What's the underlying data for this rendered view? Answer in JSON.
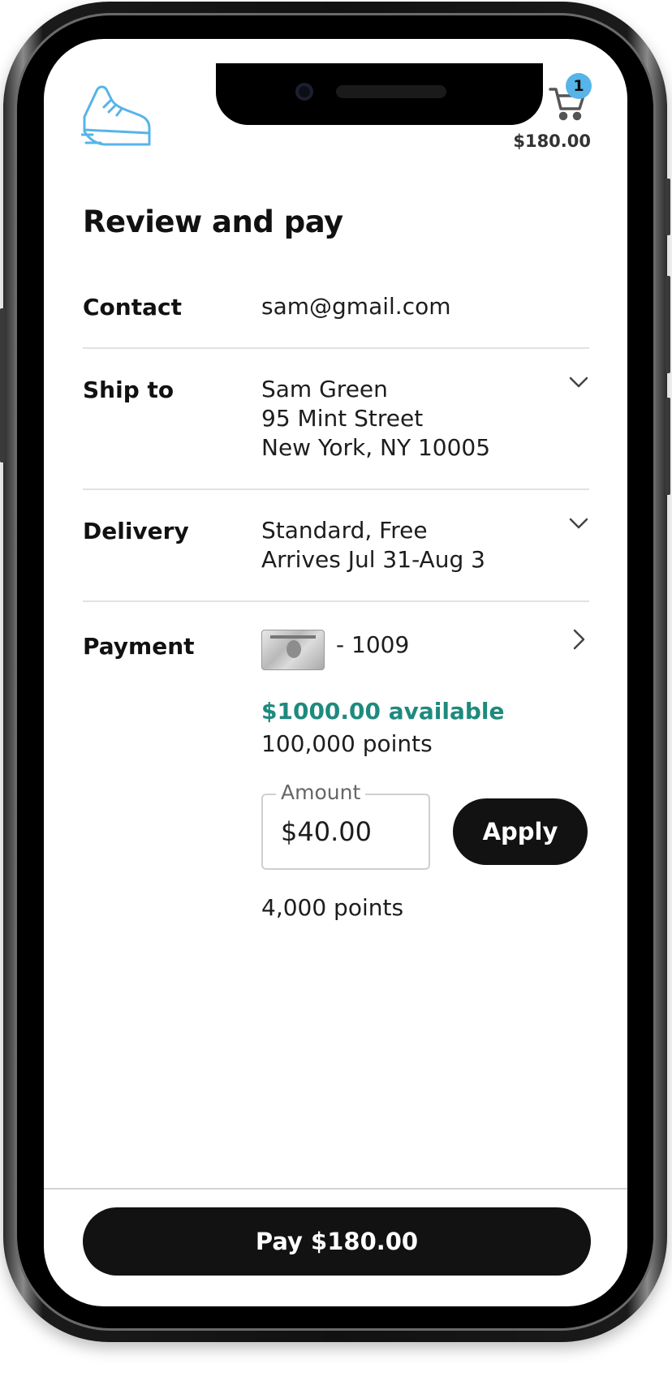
{
  "header": {
    "cart_count": "1",
    "cart_total": "$180.00"
  },
  "page": {
    "title": "Review and pay"
  },
  "contact": {
    "label": "Contact",
    "value": "sam@gmail.com"
  },
  "ship_to": {
    "label": "Ship to",
    "name": "Sam Green",
    "street": "95 Mint Street",
    "city": "New York, NY 10005"
  },
  "delivery": {
    "label": "Delivery",
    "method": "Standard, Free",
    "arrival": "Arrives Jul 31-Aug 3"
  },
  "payment": {
    "label": "Payment",
    "card_last4": "- 1009",
    "available": "$1000.00 available",
    "points": "100,000 points",
    "amount_label": "Amount",
    "amount_value": "$40.00",
    "apply_label": "Apply",
    "points_applied": "4,000 points"
  },
  "footer": {
    "pay_label": "Pay $180.00"
  },
  "colors": {
    "accent_blue": "#56b4e9",
    "available_green": "#1e8a7e",
    "button_dark": "#121212"
  }
}
